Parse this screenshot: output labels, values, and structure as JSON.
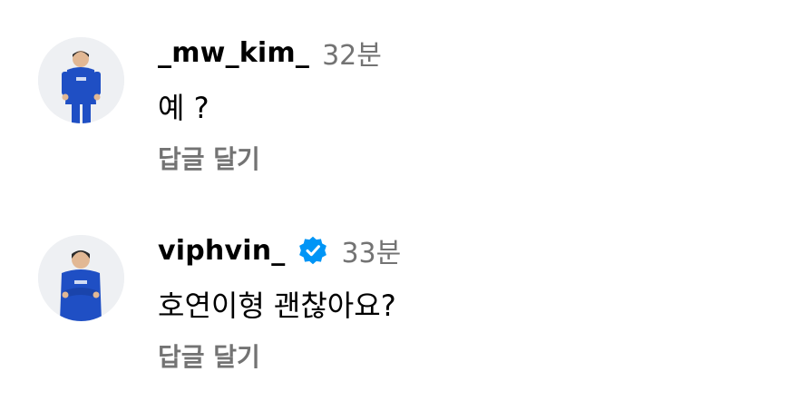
{
  "comments": [
    {
      "username": "_mw_kim_",
      "verified": false,
      "time": "32분",
      "text": "예 ?",
      "reply_label": "답글 달기",
      "avatar_icon": "player-photo-avatar"
    },
    {
      "username": "viphvin_",
      "verified": true,
      "time": "33분",
      "text": "호연이형 괜찮아요?",
      "reply_label": "답글 달기",
      "avatar_icon": "player-photo-avatar"
    }
  ],
  "colors": {
    "text_primary": "#000000",
    "text_secondary": "#737373",
    "verified_blue": "#0095F6",
    "jersey_blue": "#1f4fc4",
    "avatar_bg": "#eef0f3"
  }
}
